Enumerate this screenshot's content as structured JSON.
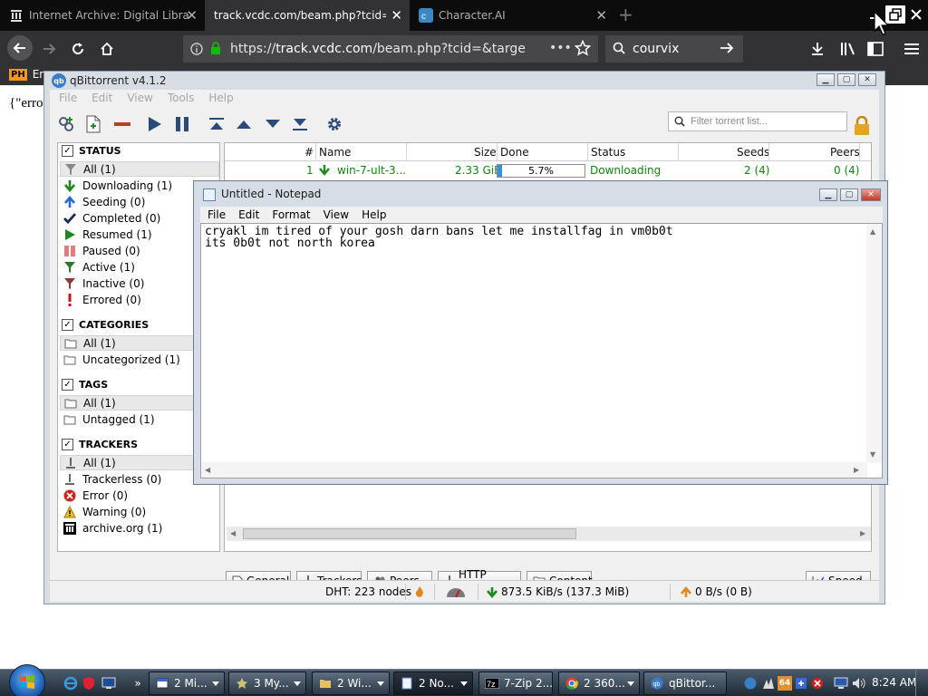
{
  "browser": {
    "tabs": [
      {
        "label": "Internet Archive: Digital Library",
        "icon": "archive-icon"
      },
      {
        "label": "track.vcdc.com/beam.php?tcid=&target=",
        "icon": "none"
      },
      {
        "label": "Character.AI",
        "icon": "character-ai-icon"
      }
    ],
    "new_tab": "+",
    "url_host": "track.vcdc.com",
    "url_prefix": "https://",
    "url_rest": "/beam.php?tcid=&target=aH",
    "search_text": "courvix",
    "bookmark_logo": "PH",
    "bookmark_label": "En"
  },
  "page": {
    "content": "{\"error"
  },
  "qbittorrent": {
    "title": "qBittorrent v4.1.2",
    "menu": [
      "File",
      "Edit",
      "View",
      "Tools",
      "Help"
    ],
    "filter_placeholder": "Filter torrent list...",
    "sidebar": {
      "status_title": "STATUS",
      "status_items": [
        {
          "label": "All (1)",
          "icon": "filter-icon"
        },
        {
          "label": "Downloading (1)",
          "icon": "arrow-down-icon"
        },
        {
          "label": "Seeding (0)",
          "icon": "arrow-up-icon"
        },
        {
          "label": "Completed (0)",
          "icon": "checkmark-icon"
        },
        {
          "label": "Resumed (1)",
          "icon": "play-icon"
        },
        {
          "label": "Paused (0)",
          "icon": "pause-icon"
        },
        {
          "label": "Active (1)",
          "icon": "filter-green-icon"
        },
        {
          "label": "Inactive (0)",
          "icon": "filter-red-icon"
        },
        {
          "label": "Errored (0)",
          "icon": "exclamation-icon"
        }
      ],
      "categories_title": "CATEGORIES",
      "categories_items": [
        {
          "label": "All (1)",
          "icon": "folder-icon"
        },
        {
          "label": "Uncategorized (1)",
          "icon": "folder-icon"
        }
      ],
      "tags_title": "TAGS",
      "tags_items": [
        {
          "label": "All (1)",
          "icon": "folder-icon"
        },
        {
          "label": "Untagged (1)",
          "icon": "folder-icon"
        }
      ],
      "trackers_title": "TRACKERS",
      "trackers_items": [
        {
          "label": "All (1)",
          "icon": "tracker-icon"
        },
        {
          "label": "Trackerless (0)",
          "icon": "tracker-icon"
        },
        {
          "label": "Error (0)",
          "icon": "error-icon"
        },
        {
          "label": "Warning (0)",
          "icon": "warning-icon"
        },
        {
          "label": "archive.org (1)",
          "icon": "archive-icon"
        }
      ]
    },
    "columns": [
      "#",
      "Name",
      "Size",
      "Done",
      "Status",
      "Seeds",
      "Peers"
    ],
    "torrents": [
      {
        "index": "1",
        "name": "win-7-ult-3...",
        "size": "2.33 GiB",
        "done": "5.7%",
        "progress": 0.057,
        "status": "Downloading",
        "seeds": "2 (4)",
        "peers": "0 (4)"
      }
    ],
    "bottom_tabs": [
      "General",
      "Trackers",
      "Peers",
      "HTTP Sources",
      "Content"
    ],
    "speed_button": "Speed",
    "statusbar": {
      "dht": "DHT: 223 nodes",
      "download": "873.5 KiB/s (137.3 MiB)",
      "upload": "0 B/s (0 B)"
    }
  },
  "notepad": {
    "title": "Untitled - Notepad",
    "menu": [
      "File",
      "Edit",
      "Format",
      "View",
      "Help"
    ],
    "text": "cryakl im tired of your gosh darn bans let me installfag in vm0b0t\nits 0b0t not north korea"
  },
  "taskbar": {
    "tasks": [
      {
        "label": "2 Mi...",
        "icon": "window-icon"
      },
      {
        "label": "3 My...",
        "icon": "star-icon"
      },
      {
        "label": "2 Wi...",
        "icon": "folder-icon"
      },
      {
        "label": "2 No...",
        "icon": "notepad-icon"
      },
      {
        "label": "7-Zip 2...",
        "icon": "zip-icon"
      },
      {
        "label": "2 360...",
        "icon": "chrome-icon"
      },
      {
        "label": "qBittor...",
        "icon": "qbittorrent-icon"
      }
    ],
    "tray_badge": "64",
    "clock": "8:24 AM"
  },
  "colors": {
    "accent_green": "#0b8a0b",
    "progress_blue": "#3a8ee0",
    "firefox_dark": "#323234"
  }
}
